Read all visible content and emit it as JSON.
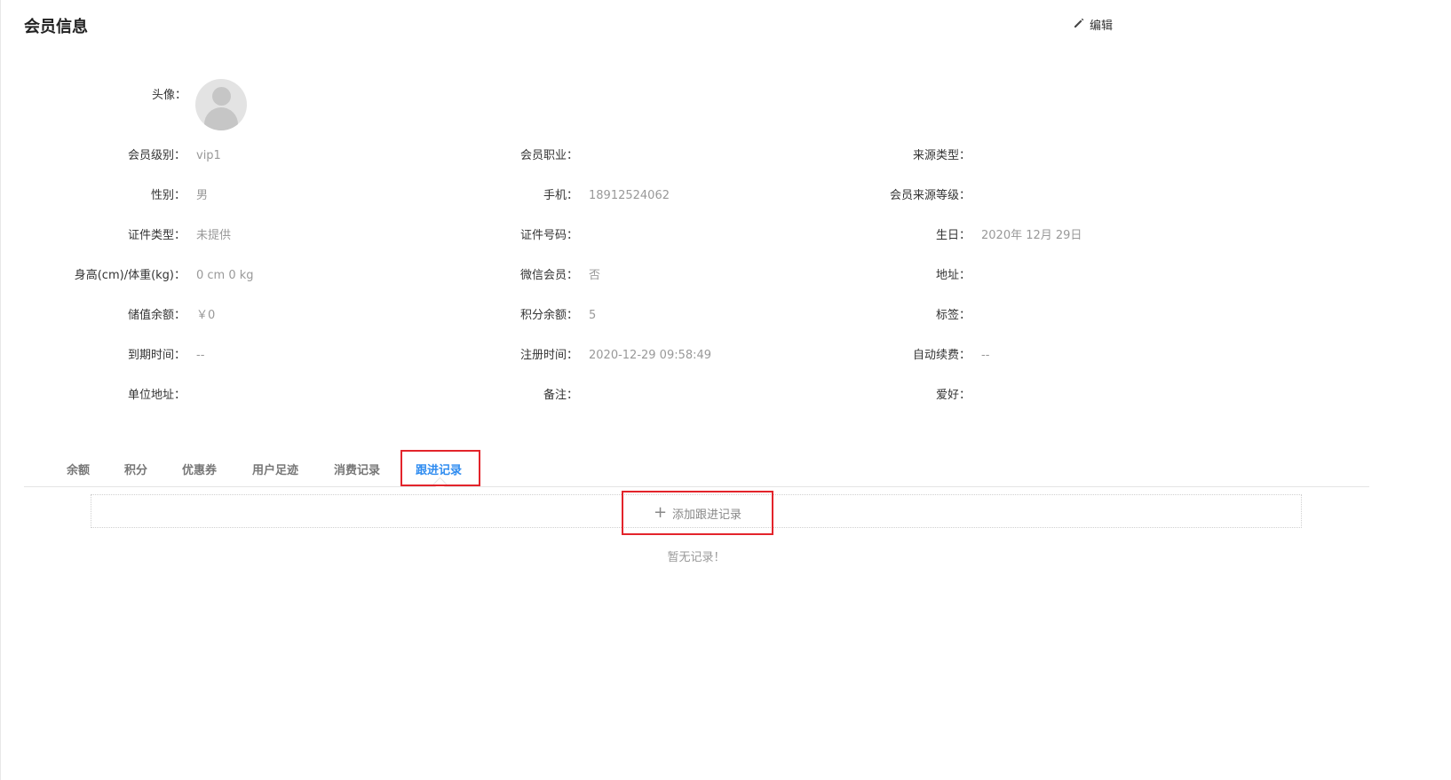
{
  "header": {
    "title": "会员信息",
    "edit_label": "编辑"
  },
  "avatar": {
    "label": "头像："
  },
  "fields": [
    {
      "label": "会员级别：",
      "value": "vip1"
    },
    {
      "label": "会员职业：",
      "value": ""
    },
    {
      "label": "来源类型：",
      "value": ""
    },
    {
      "label": "性别：",
      "value": "男"
    },
    {
      "label": "手机：",
      "value": "18912524062"
    },
    {
      "label": "会员来源等级：",
      "value": ""
    },
    {
      "label": "证件类型：",
      "value": "未提供"
    },
    {
      "label": "证件号码：",
      "value": ""
    },
    {
      "label": "生日：",
      "value": "2020年 12月 29日"
    },
    {
      "label": "身高(cm)/体重(kg)：",
      "value": "0 cm 0 kg"
    },
    {
      "label": "微信会员：",
      "value": "否"
    },
    {
      "label": "地址：",
      "value": ""
    },
    {
      "label": "储值余额：",
      "value": "￥0"
    },
    {
      "label": "积分余额：",
      "value": "5"
    },
    {
      "label": "标签：",
      "value": ""
    },
    {
      "label": "到期时间：",
      "value": "--"
    },
    {
      "label": "注册时间：",
      "value": "2020-12-29 09:58:49"
    },
    {
      "label": "自动续费：",
      "value": "--"
    },
    {
      "label": "单位地址：",
      "value": ""
    },
    {
      "label": "备注：",
      "value": ""
    },
    {
      "label": "爱好：",
      "value": ""
    }
  ],
  "tabs": [
    {
      "label": "余额"
    },
    {
      "label": "积分"
    },
    {
      "label": "优惠券"
    },
    {
      "label": "用户足迹"
    },
    {
      "label": "消费记录"
    },
    {
      "label": "跟进记录",
      "active": true
    }
  ],
  "followup": {
    "add_label": "添加跟进记录",
    "empty_text": "暂无记录！"
  },
  "colors": {
    "accent": "#2f8cf0",
    "highlight": "#e3242b"
  }
}
